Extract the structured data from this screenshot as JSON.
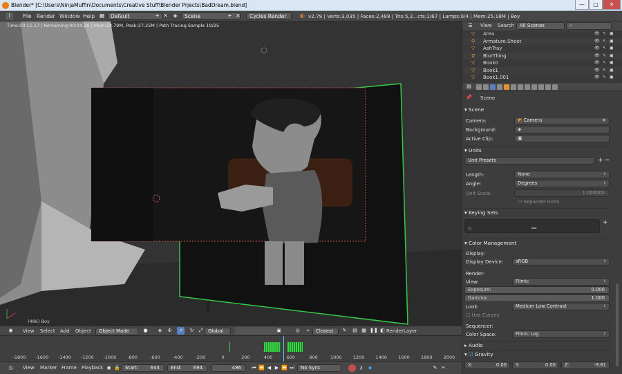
{
  "window": {
    "title": "Blender* [C:\\Users\\NinjaMuffin\\Documents\\Creative Stuff\\Blender Prjects\\BadDream.blend]",
    "min": "—",
    "max": "□",
    "close": "✕"
  },
  "info": {
    "menus": [
      "File",
      "Render",
      "Window",
      "Help"
    ],
    "screen": "Default",
    "scene": "Scene",
    "engine": "Cycles Render",
    "stats": "v2.79 | Verts:3,035 | Faces:2,489 | Tris:5,2...cts:1/67 | Lamps:0/4 | Mem:25.18M | Boy",
    "add": "+",
    "x": "✕"
  },
  "viewport": {
    "render_status": "Time:00:11.17 | Remaining:00:04.26 | Mem:18.79M, Peak:37.25M | Path Tracing Sample 19/25",
    "object_label": "(486) Boy",
    "header": {
      "menus": [
        "View",
        "Select",
        "Add",
        "Object"
      ],
      "mode": "Object Mode",
      "orientation": "Global",
      "snap": "Closest",
      "layer": "RenderLayer"
    }
  },
  "timeline": {
    "ticks": [
      "-1800",
      "-1600",
      "-1400",
      "-1200",
      "-1000",
      "-800",
      "-600",
      "-400",
      "-200",
      "0",
      "200",
      "400",
      "600",
      "800",
      "1000",
      "1200",
      "1400",
      "1600",
      "1800",
      "2000"
    ],
    "header": {
      "menus": [
        "View",
        "Marker",
        "Frame",
        "Playback"
      ],
      "start": "Start:",
      "start_val": "644",
      "end": "End:",
      "end_val": "694",
      "current": "486",
      "sync": "No Sync"
    }
  },
  "outliner": {
    "header": {
      "view": "View",
      "search": "Search",
      "filter": "All Scenes"
    },
    "items": [
      "Area",
      "Armature.Sheet",
      "AshTray",
      "BlurThing",
      "Book0",
      "Book1",
      "Book1.001"
    ]
  },
  "properties": {
    "breadcrumb": "Scene",
    "scene_panel": {
      "title": "Scene",
      "camera_label": "Camera:",
      "camera_value": "Camera",
      "background_label": "Background:",
      "clip_label": "Active Clip:"
    },
    "units_panel": {
      "title": "Units",
      "presets": "Unit Presets",
      "length_label": "Length:",
      "length_value": "None",
      "angle_label": "Angle:",
      "angle_value": "Degrees",
      "scale_label": "Unit Scale:",
      "scale_value": "1.000000",
      "separate": "Separate Units"
    },
    "keying_panel": {
      "title": "Keying Sets",
      "add": "+"
    },
    "color_panel": {
      "title": "Color Management",
      "display_label": "Display:",
      "display_device_label": "Display Device:",
      "display_device_value": "sRGB",
      "render_label": "Render:",
      "view_label": "View:",
      "view_value": "Filmic",
      "exposure_label": "Exposure:",
      "exposure_value": "0.000",
      "gamma_label": "Gamma:",
      "gamma_value": "1.000",
      "look_label": "Look:",
      "look_value": "Medium Low Contrast",
      "curves": "Use Curves",
      "sequencer_label": "Sequencer:",
      "colorspace_label": "Color Space:",
      "colorspace_value": "Filmic Log"
    },
    "audio_panel": {
      "title": "Audio"
    },
    "gravity_panel": {
      "title": "Gravity",
      "x_label": "X:",
      "x": "0.00",
      "y_label": "Y:",
      "y": "0.00",
      "z_label": "Z:",
      "z": "-9.81"
    }
  }
}
